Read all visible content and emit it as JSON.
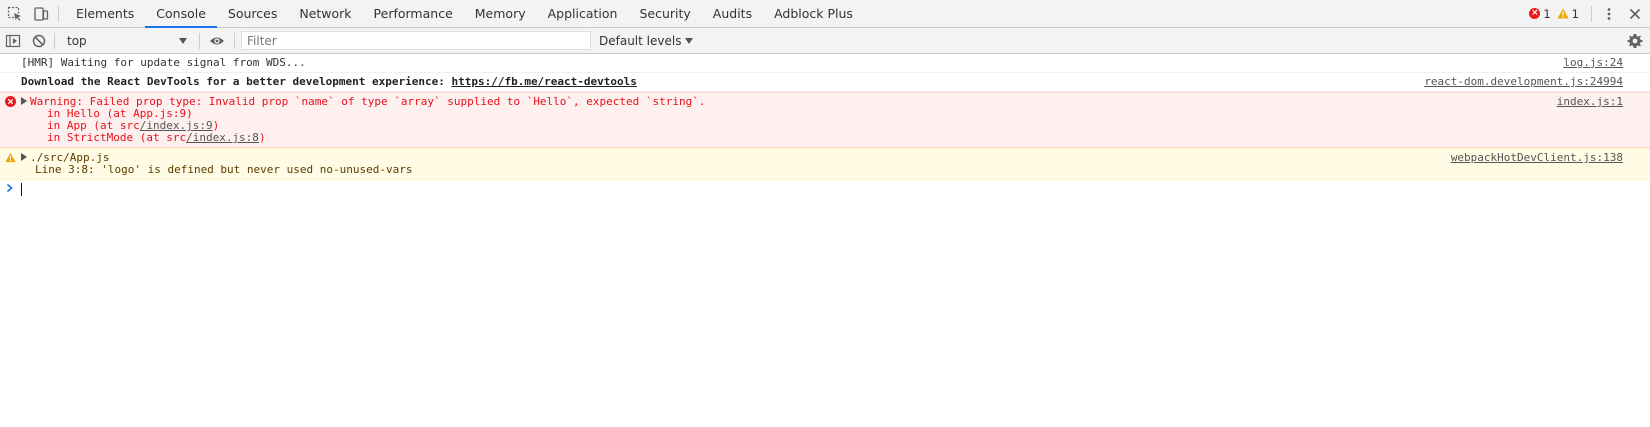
{
  "tabs": [
    {
      "label": "Elements"
    },
    {
      "label": "Console",
      "active": true
    },
    {
      "label": "Sources"
    },
    {
      "label": "Network"
    },
    {
      "label": "Performance"
    },
    {
      "label": "Memory"
    },
    {
      "label": "Application"
    },
    {
      "label": "Security"
    },
    {
      "label": "Audits"
    },
    {
      "label": "Adblock Plus"
    }
  ],
  "counters": {
    "errors": "1",
    "warnings": "1"
  },
  "toolbar": {
    "context": "top",
    "filter_placeholder": "Filter",
    "filter_value": "",
    "levels": "Default levels"
  },
  "messages": {
    "hmr": {
      "text": "[HMR] Waiting for update signal from WDS...",
      "source": "log.js:24"
    },
    "react": {
      "text": "Download the React DevTools for a better development experience: ",
      "link": "https://fb.me/react-devtools",
      "source": "react-dom.development.js:24994"
    },
    "error": {
      "text": "Warning: Failed prop type: Invalid prop `name` of type `array` supplied to `Hello`, expected `string`.",
      "source": "index.js:1",
      "stack": {
        "line1": "in Hello (at App.js:9)",
        "line2_prefix": "in App (at src",
        "line2_link": "/index.js:9",
        "line2_suffix": ")",
        "line3_prefix": "in StrictMode (at src",
        "line3_link": "/index.js:8",
        "line3_suffix": ")"
      }
    },
    "warning": {
      "text": "./src/App.js",
      "detail": "Line 3:8:  'logo' is defined but never used  no-unused-vars",
      "source": "webpackHotDevClient.js:138"
    }
  },
  "colors": {
    "accent": "#1a73e8",
    "error_bg": "#fff0f0",
    "error_text": "#e8101a",
    "warning_bg": "#fffbe5",
    "warning_icon": "#f2a600"
  }
}
